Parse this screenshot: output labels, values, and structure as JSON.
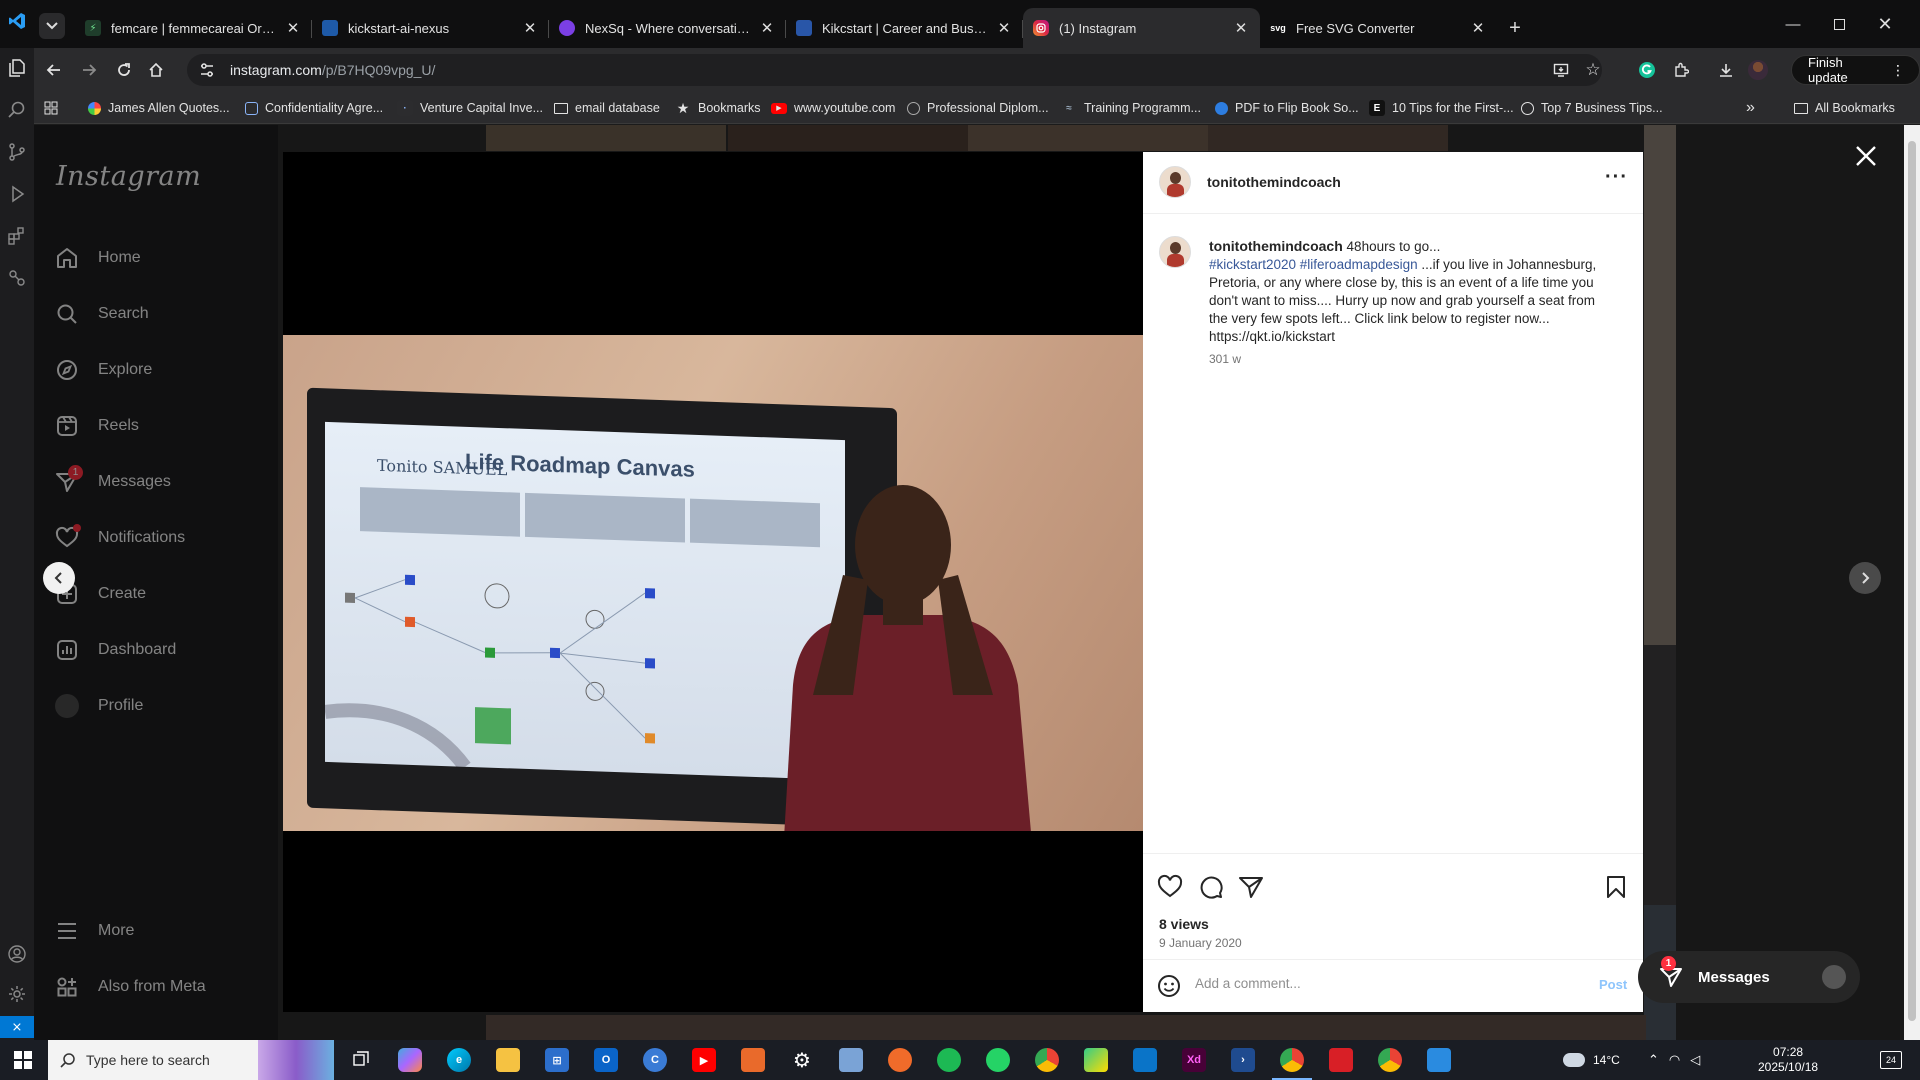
{
  "browser": {
    "tabs": [
      {
        "title": "femcare | femmecareai Org | Su",
        "favicon": "green-bolt-icon",
        "color": "#1f3d2b"
      },
      {
        "title": "kickstart-ai-nexus",
        "favicon": "lovable-icon",
        "color": "#1e5aa8"
      },
      {
        "title": "NexSq - Where conversation an",
        "favicon": "nexsq-icon",
        "color": "#7b3fe4"
      },
      {
        "title": "Kikcstart | Career and Business",
        "favicon": "kickstart-icon",
        "color": "#2956a8"
      },
      {
        "title": "(1) Instagram",
        "favicon": "instagram-icon",
        "color": "#e1306c"
      },
      {
        "title": "Free SVG Converter",
        "favicon": "svg-icon",
        "color": "#333333"
      }
    ],
    "url_host": "instagram.com",
    "url_path": "/p/B7HQ09vpg_U/",
    "finish_update": "Finish update",
    "bookmarks": [
      "James Allen Quotes...",
      "Confidentiality Agre...",
      "Venture Capital Inve...",
      "email database",
      "Bookmarks",
      "www.youtube.com",
      "Professional Diplom...",
      "Training Programm...",
      "PDF to Flip Book So...",
      "10 Tips for the First-...",
      "Top 7 Business Tips..."
    ],
    "all_bookmarks": "All Bookmarks",
    "more_bookmarks": "»"
  },
  "instagram": {
    "logo": "Instagram",
    "nav": [
      {
        "label": "Home",
        "icon": "home-icon"
      },
      {
        "label": "Search",
        "icon": "search-icon"
      },
      {
        "label": "Explore",
        "icon": "compass-icon"
      },
      {
        "label": "Reels",
        "icon": "reels-icon"
      },
      {
        "label": "Messages",
        "icon": "messenger-icon",
        "badge": "1"
      },
      {
        "label": "Notifications",
        "icon": "heart-icon"
      },
      {
        "label": "Create",
        "icon": "plus-square-icon"
      },
      {
        "label": "Dashboard",
        "icon": "dashboard-icon"
      },
      {
        "label": "Profile",
        "icon": "profile-avatar-icon"
      }
    ],
    "bottom_nav": [
      {
        "label": "More",
        "icon": "menu-icon"
      },
      {
        "label": "Also from Meta",
        "icon": "meta-apps-icon"
      }
    ],
    "video": {
      "screen_title": "Life Roadmap Canvas",
      "screen_name": "Tonito SAMUEL"
    },
    "post": {
      "username": "tonitothemindcoach",
      "caption_lead": "48hours to go...",
      "hashtags": "#kickstart2020 #liferoadmapdesign",
      "caption_body": "...if you live in Johannesburg, Pretoria, or any where close by, this is an event of a life time you don't want to miss.... Hurry up now and grab yourself a seat from the very few spots left... Click link below to register now... https://qkt.io/kickstart",
      "time": "301 w",
      "views": "8 views",
      "date": "9 January 2020",
      "comment_placeholder": "Add a comment...",
      "post_label": "Post"
    },
    "messages_pill": {
      "label": "Messages",
      "badge": "1"
    }
  },
  "taskbar": {
    "search_placeholder": "Type here to search",
    "weather": "14°C",
    "time": "07:28",
    "date": "2025/10/18",
    "notifications": "24"
  },
  "colors": {
    "accent_blue": "#0095f6",
    "hashtag": "#385898",
    "badge_red": "#ff3040"
  }
}
